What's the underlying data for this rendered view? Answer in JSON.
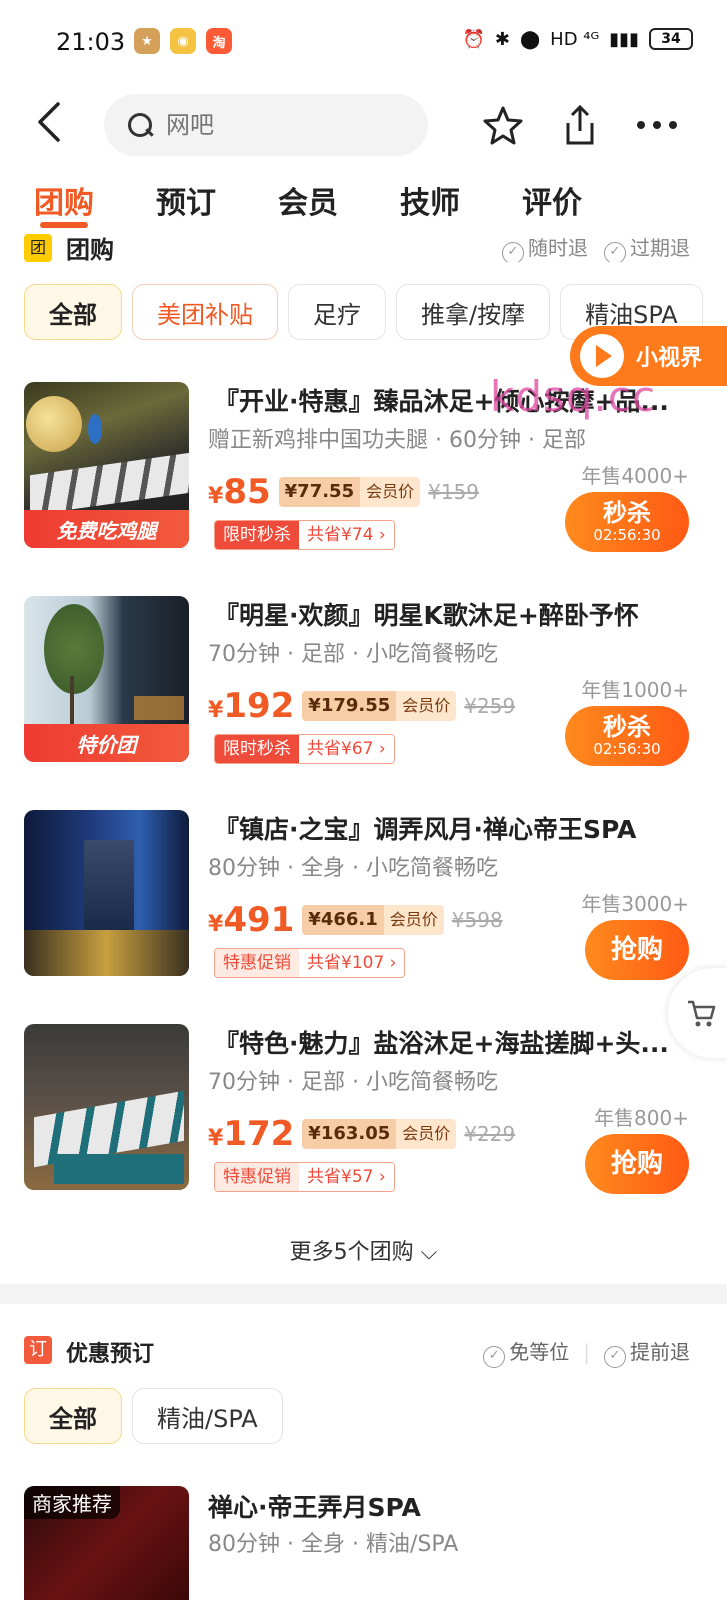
{
  "status": {
    "time": "21:03",
    "network": "HD ⁴ᴳ",
    "battery": "34"
  },
  "top_bar": {
    "search_placeholder": "网吧"
  },
  "tabs": [
    "团购",
    "预订",
    "会员",
    "技师",
    "评价"
  ],
  "group_section": {
    "title": "团购",
    "tags": [
      "随时退",
      "过期退"
    ]
  },
  "filter_chips": [
    "全部",
    "美团补贴",
    "足疗",
    "推拿/按摩",
    "精油SPA"
  ],
  "floating_badge": "小视界",
  "watermark": "kdsq.cc",
  "deals": [
    {
      "thumb_tag": "免费吃鸡腿",
      "title": "『开业·特惠』臻品沐足+倾心按摩+品...",
      "subtitle": "赠正新鸡排中国功夫腿 · 60分钟 · 足部",
      "price": "85",
      "member_price": "¥77.55",
      "member_label": "会员价",
      "original_price": "¥159",
      "promo_label": "限时秒杀",
      "promo_save": "共省¥74 ›",
      "sales": "年售4000+",
      "button_main": "秒杀",
      "button_sub": "02:56:30"
    },
    {
      "thumb_tag": "特价团",
      "title": "『明星·欢颜』明星K歌沐足+醉卧予怀",
      "subtitle": "70分钟 · 足部 · 小吃简餐畅吃",
      "price": "192",
      "member_price": "¥179.55",
      "member_label": "会员价",
      "original_price": "¥259",
      "promo_label": "限时秒杀",
      "promo_save": "共省¥67 ›",
      "sales": "年售1000+",
      "button_main": "秒杀",
      "button_sub": "02:56:30"
    },
    {
      "thumb_tag": "",
      "title": "『镇店·之宝』调弄风月·禅心帝王SPA",
      "subtitle": "80分钟 · 全身 · 小吃简餐畅吃",
      "price": "491",
      "member_price": "¥466.1",
      "member_label": "会员价",
      "original_price": "¥598",
      "promo_label": "特惠促销",
      "promo_save": "共省¥107 ›",
      "sales": "年售3000+",
      "button_main": "抢购",
      "button_sub": ""
    },
    {
      "thumb_tag": "",
      "title": "『特色·魅力』盐浴沐足+海盐搓脚+头...",
      "subtitle": "70分钟 · 足部 · 小吃简餐畅吃",
      "price": "172",
      "member_price": "¥163.05",
      "member_label": "会员价",
      "original_price": "¥229",
      "promo_label": "特惠促销",
      "promo_save": "共省¥57 ›",
      "sales": "年售800+",
      "button_main": "抢购",
      "button_sub": ""
    }
  ],
  "more_deals": "更多5个团购 ⌵",
  "reservation": {
    "icon": "订",
    "title": "优惠预订",
    "tags": [
      "免等位",
      "提前退"
    ],
    "chips": [
      "全部",
      "精油/SPA"
    ],
    "item": {
      "thumb_tag": "商家推荐",
      "name": "禅心·帝王弄月SPA",
      "subtitle": "80分钟 · 全身 · 精油/SPA"
    }
  },
  "colors": {
    "accent": "#f05a24",
    "promo_red": "#ef4b3a",
    "chip_selected_bg": "#fff8e6"
  }
}
